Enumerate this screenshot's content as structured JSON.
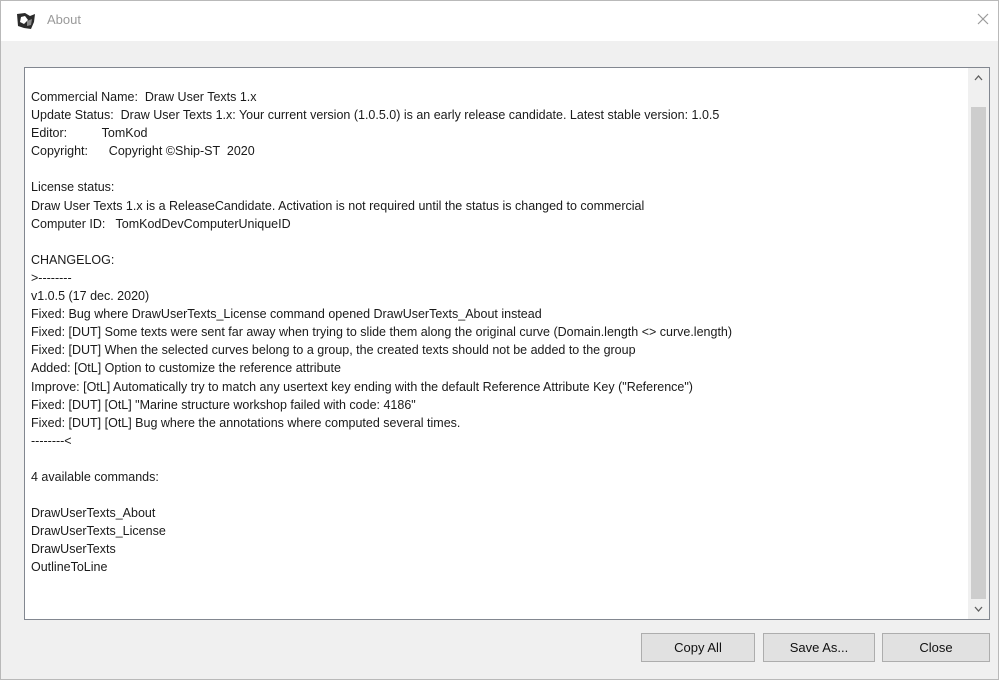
{
  "window": {
    "title": "About",
    "close_glyph": "×"
  },
  "about_text": {
    "lines": [
      "Commercial Name:  Draw User Texts 1.x",
      "Update Status:  Draw User Texts 1.x: Your current version (1.0.5.0) is an early release candidate. Latest stable version: 1.0.5",
      "Editor:          TomKod",
      "Copyright:      Copyright ©Ship-ST  2020",
      "",
      "License status:",
      "Draw User Texts 1.x is a ReleaseCandidate. Activation is not required until the status is changed to commercial",
      "Computer ID:   TomKodDevComputerUniqueID",
      "",
      "CHANGELOG:",
      ">--------",
      "v1.0.5 (17 dec. 2020)",
      "Fixed: Bug where DrawUserTexts_License command opened DrawUserTexts_About instead",
      "Fixed: [DUT] Some texts were sent far away when trying to slide them along the original curve (Domain.length <> curve.length)",
      "Fixed: [DUT] When the selected curves belong to a group, the created texts should not be added to the group",
      "Added: [OtL] Option to customize the reference attribute",
      "Improve: [OtL] Automatically try to match any usertext key ending with the default Reference Attribute Key (\"Reference\")",
      "Fixed: [DUT] [OtL] \"Marine structure workshop failed with code: 4186\"",
      "Fixed: [DUT] [OtL] Bug where the annotations where computed several times.",
      "--------<",
      "",
      "4 available commands:",
      "",
      "DrawUserTexts_About",
      "DrawUserTexts_License",
      "DrawUserTexts",
      "OutlineToLine"
    ]
  },
  "buttons": {
    "copy_all": "Copy All",
    "save_as": "Save As...",
    "close": "Close"
  }
}
